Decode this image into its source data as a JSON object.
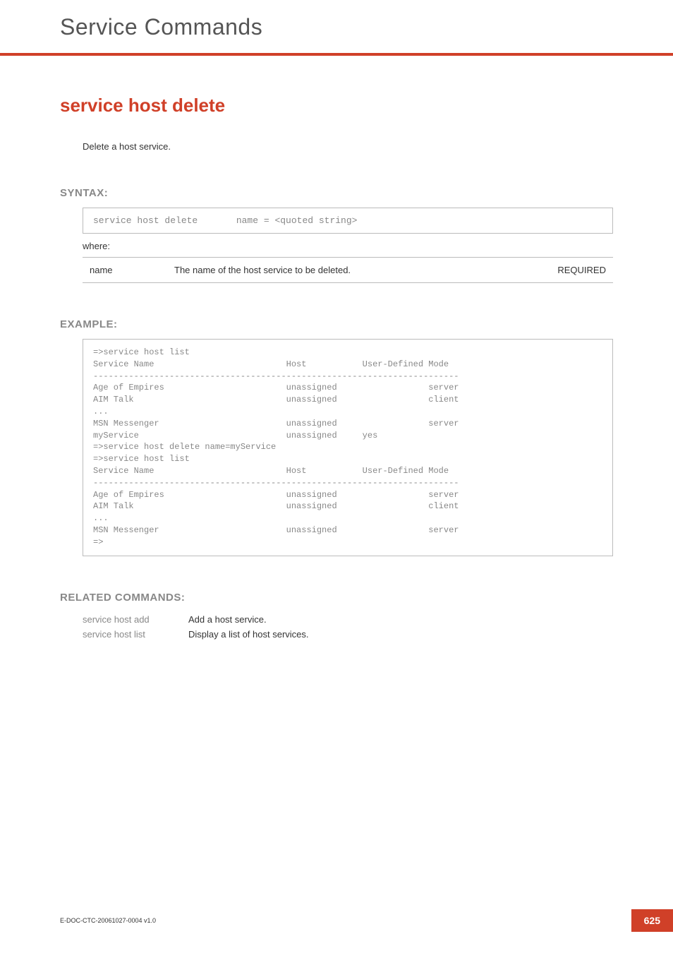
{
  "page": {
    "title": "Service Commands",
    "footer_doc": "E-DOC-CTC-20061027-0004 v1.0",
    "page_number": "625"
  },
  "section": {
    "title": "service host delete",
    "description": "Delete a host service."
  },
  "syntax": {
    "heading": "SYNTAX:",
    "code": "service host delete       name = <quoted string>",
    "where": "where:",
    "params": [
      {
        "name": "name",
        "desc": "The name of the host service to be deleted.",
        "req": "REQUIRED"
      }
    ]
  },
  "example": {
    "heading": "EXAMPLE:",
    "code": "=>service host list\nService Name                          Host           User-Defined Mode\n------------------------------------------------------------------------\nAge of Empires                        unassigned                  server\nAIM Talk                              unassigned                  client\n...\nMSN Messenger                         unassigned                  server\nmyService                             unassigned     yes\n=>service host delete name=myService\n=>service host list\nService Name                          Host           User-Defined Mode\n------------------------------------------------------------------------\nAge of Empires                        unassigned                  server\nAIM Talk                              unassigned                  client\n...\nMSN Messenger                         unassigned                  server\n=>"
  },
  "related": {
    "heading": "RELATED COMMANDS:",
    "items": [
      {
        "cmd": "service host add",
        "desc": "Add a host service."
      },
      {
        "cmd": "service host list",
        "desc": "Display a list of host services."
      }
    ]
  }
}
